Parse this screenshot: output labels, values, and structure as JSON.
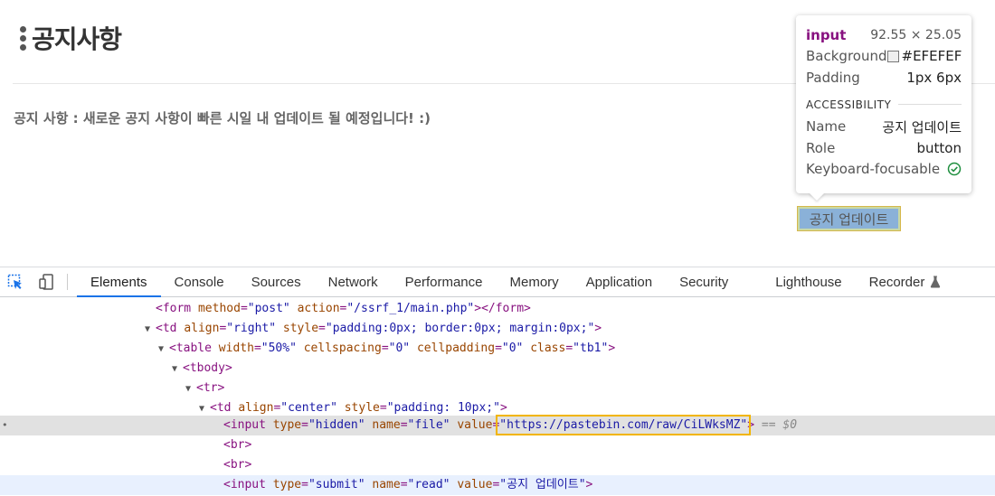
{
  "page": {
    "title": "공지사항",
    "notice": "공지 사항 : 새로운 공지 사항이 빠른 시일 내 업데이트 될 예정입니다! :)",
    "update_button": "공지 업데이트"
  },
  "tooltip": {
    "tag": "input",
    "dimensions": "92.55 × 25.05",
    "background_label": "Background",
    "background_value": "#EFEFEF",
    "padding_label": "Padding",
    "padding_value": "1px 6px",
    "section_title": "ACCESSIBILITY",
    "name_label": "Name",
    "name_value": "공지 업데이트",
    "role_label": "Role",
    "role_value": "button",
    "focus_label": "Keyboard-focusable"
  },
  "devtools": {
    "tabs": [
      "Elements",
      "Console",
      "Sources",
      "Network",
      "Performance",
      "Memory",
      "Application",
      "Security",
      "Lighthouse",
      "Recorder"
    ],
    "active_tab": "Elements"
  },
  "dom": {
    "form_open": "<form",
    "form_method_attr": "method",
    "form_method_val": "\"post\"",
    "form_action_attr": "action",
    "form_action_val": "\"/ssrf_1/main.php\"",
    "form_close": "></form>",
    "td1_open": "<td",
    "td1_align_attr": "align",
    "td1_align_val": "\"right\"",
    "td1_style_attr": "style",
    "td1_style_val": "\"padding:0px; border:0px; margin:0px;\"",
    "td1_close": ">",
    "table_open": "<table",
    "table_width_attr": "width",
    "table_width_val": "\"50%\"",
    "table_cs_attr": "cellspacing",
    "table_cs_val": "\"0\"",
    "table_cp_attr": "cellpadding",
    "table_cp_val": "\"0\"",
    "table_class_attr": "class",
    "table_class_val": "\"tb1\"",
    "table_close": ">",
    "tbody": "<tbody>",
    "tr": "<tr>",
    "td2_open": "<td",
    "td2_align_attr": "align",
    "td2_align_val": "\"center\"",
    "td2_style_attr": "style",
    "td2_style_val": "\"padding: 10px;\"",
    "td2_close": ">",
    "input1_open": "<input",
    "input1_type_attr": "type",
    "input1_type_val": "\"hidden\"",
    "input1_name_attr": "name",
    "input1_name_val": "\"file\"",
    "input1_value_attr": "value",
    "input1_value_val": "\"https://pastebin.com/raw/CiLWksMZ\"",
    "input1_close": ">",
    "selected_marker": "== $0",
    "br": "<br>",
    "input2_open": "<input",
    "input2_type_attr": "type",
    "input2_type_val": "\"submit\"",
    "input2_name_attr": "name",
    "input2_name_val": "\"read\"",
    "input2_value_attr": "value",
    "input2_value_val": "\"공지 업데이트\"",
    "input2_close": ">"
  }
}
